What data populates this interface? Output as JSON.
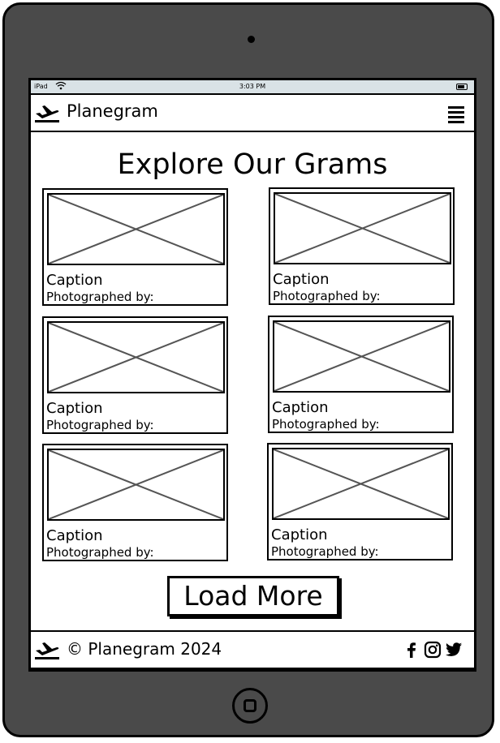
{
  "device": {
    "name": "iPad"
  },
  "statusbar": {
    "carrier": "iPad",
    "time": "3:03 PM"
  },
  "navbar": {
    "brand": "Planegram",
    "brand_icon": "plane-departure-icon",
    "menu_icon": "hamburger-menu-icon"
  },
  "main": {
    "title": "Explore Our Grams",
    "cards": [
      {
        "caption": "Caption",
        "credit": "Photographed by:"
      },
      {
        "caption": "Caption",
        "credit": "Photographed by:"
      },
      {
        "caption": "Caption",
        "credit": "Photographed by:"
      },
      {
        "caption": "Caption",
        "credit": "Photographed by:"
      },
      {
        "caption": "Caption",
        "credit": "Photographed by:"
      },
      {
        "caption": "Caption",
        "credit": "Photographed by:"
      }
    ],
    "load_more_label": "Load More"
  },
  "footer": {
    "copyright": "© Planegram 2024",
    "social_icons": [
      "facebook-icon",
      "instagram-icon",
      "twitter-icon"
    ]
  },
  "colors": {
    "device_body": "#4a4a4a",
    "statusbar_bg": "#d9e2e6",
    "ink": "#000000",
    "placeholder_line": "#555555"
  }
}
